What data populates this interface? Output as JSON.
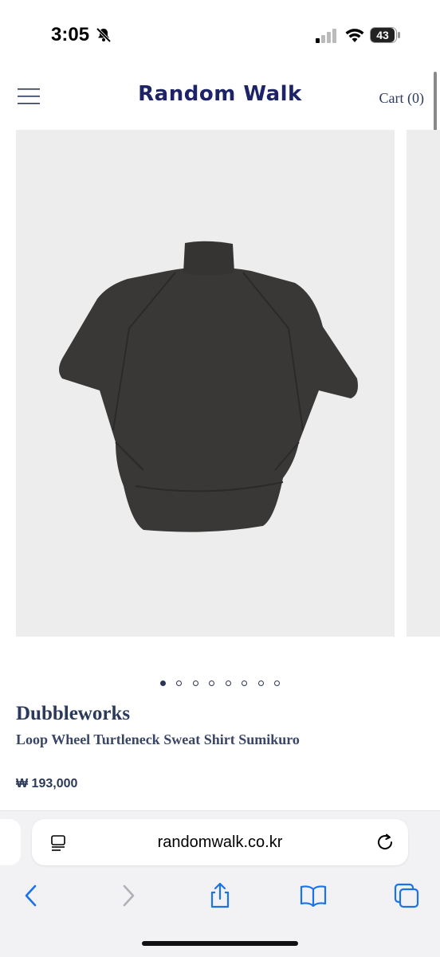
{
  "status": {
    "time": "3:05",
    "battery": "43"
  },
  "header": {
    "brand": "Random Walk",
    "cart_label": "Cart (0)"
  },
  "gallery": {
    "slide_count": 8,
    "active_slide": 1,
    "image_alt": "Loop Wheel Turtleneck Sweat Shirt Sumikuro"
  },
  "product": {
    "vendor": "Dubbleworks",
    "title": "Loop Wheel Turtleneck Sweat Shirt Sumikuro",
    "price": "₩ 193,000"
  },
  "browser": {
    "url": "randomwalk.co.kr"
  },
  "colors": {
    "brand": "#1c2366",
    "text": "#2b3a5a",
    "accent_ios": "#1a73e8"
  }
}
